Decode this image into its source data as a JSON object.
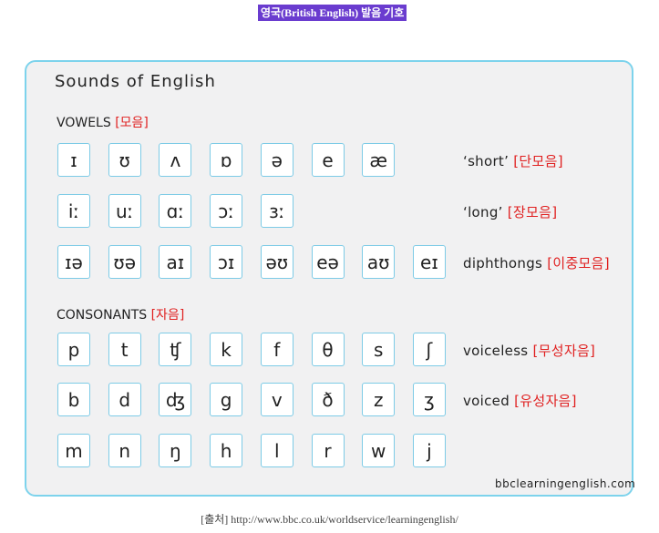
{
  "header": {
    "title": "영국(British English) 발음 기호"
  },
  "card": {
    "title": "Sounds of English",
    "vowels": {
      "label": "VOWELS",
      "label_ko": "[모음]"
    },
    "consonants": {
      "label": "CONSONANTS",
      "label_ko": "[자음]"
    },
    "rows": [
      {
        "tiles": [
          "ɪ",
          "ʊ",
          "ʌ",
          "ɒ",
          "ə",
          "e",
          "æ"
        ],
        "label": "‘short’",
        "label_ko": "[단모음]"
      },
      {
        "tiles": [
          "iː",
          "uː",
          "ɑː",
          "ɔː",
          "ɜː"
        ],
        "label": "‘long’",
        "label_ko": "[장모음]"
      },
      {
        "tiles": [
          "ɪə",
          "ʊə",
          "aɪ",
          "ɔɪ",
          "əʊ",
          "eə",
          "aʊ",
          "eɪ"
        ],
        "label": "diphthongs",
        "label_ko": "[이중모음]"
      },
      {
        "tiles": [
          "p",
          "t",
          "ʧ",
          "k",
          "f",
          "θ",
          "s",
          "ʃ"
        ],
        "label": "voiceless",
        "label_ko": "[무성자음]"
      },
      {
        "tiles": [
          "b",
          "d",
          "ʤ",
          "g",
          "v",
          "ð",
          "z",
          "ʒ"
        ],
        "label": "voiced",
        "label_ko": "[유성자음]"
      },
      {
        "tiles": [
          "m",
          "n",
          "ŋ",
          "h",
          "l",
          "r",
          "w",
          "j"
        ],
        "label": "",
        "label_ko": ""
      }
    ],
    "footer": "bbclearningenglish.com"
  },
  "source": "[출처] http://www.bbc.co.uk/worldservice/learningenglish/",
  "colors": {
    "accent_border": "#7dd3ec",
    "korean_text": "#e02020",
    "title_bg": "#6a3ccf",
    "card_bg": "#f1f1f2"
  }
}
